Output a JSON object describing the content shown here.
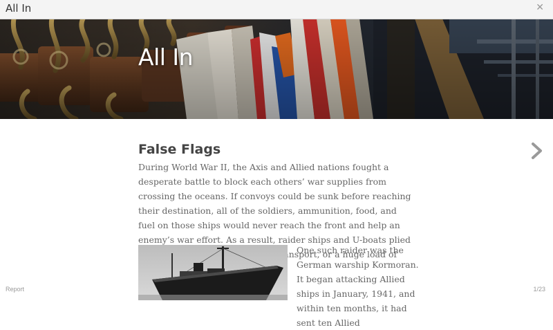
{
  "app": {
    "title": "All In"
  },
  "hero": {
    "title": "All In"
  },
  "article": {
    "heading": "False Flags",
    "paragraph": "During World War II, the Axis and Allied nations fought a desperate battle to block each others’ war supplies from crossing the oceans. If convoys could be sunk before reaching their destination, all of the soldiers, ammunition, food, and fuel on those ships would never reach the front and help an enemy’s war effort. As a result, raider ships and U-boats plied the waters in search of a troop transport, or a huge load of ammunition, food, or fuel.",
    "caption": "One such raider was the German warship Kormoran. It began attacking Allied ships in January, 1941, and within ten months, it had sent ten Allied"
  },
  "footer": {
    "report_label": "Report",
    "page_indicator": "1/23"
  },
  "icons": {
    "close": "close-icon",
    "next": "chevron-right-icon"
  },
  "colors": {
    "topbar_bg": "#f4f4f4",
    "heading": "#444444",
    "body_text": "#666666",
    "icon_gray": "#9a9a9a"
  }
}
